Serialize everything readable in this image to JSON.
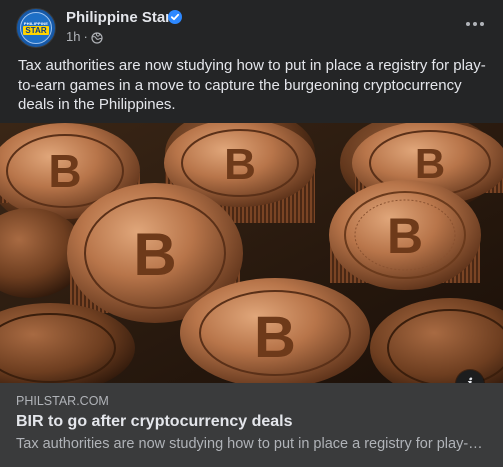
{
  "post": {
    "page_name": "Philippine Star",
    "verified_badge_icon": "verified-check-icon",
    "time": "1h",
    "separator": "·",
    "audience_icon": "globe-icon",
    "more_icon": "ellipsis-icon",
    "logo_top": "PHILIPPINE",
    "logo_main": "STAR",
    "text": "Tax authorities are now studying how to put in place a registry for play-to-earn games in a move to capture the burgeoning cryptocurrency deals in the Philippines."
  },
  "image": {
    "description_icon": "bitcoin-coins-photo",
    "info_label": "i"
  },
  "link_preview": {
    "domain": "PHILSTAR.COM",
    "title": "BIR to go after cryptocurrency deals",
    "description": "Tax authorities are now studying how to put in place a registry for play-to-earn games in a move to capture the burgeoning cryptocurrency deals in the Philippines."
  },
  "colors": {
    "background": "#242526",
    "link_box": "#3a3b3c",
    "primary_text": "#e4e6eb",
    "secondary_text": "#b0b3b8",
    "verified": "#2d88ff",
    "coin": "#b8754a"
  }
}
